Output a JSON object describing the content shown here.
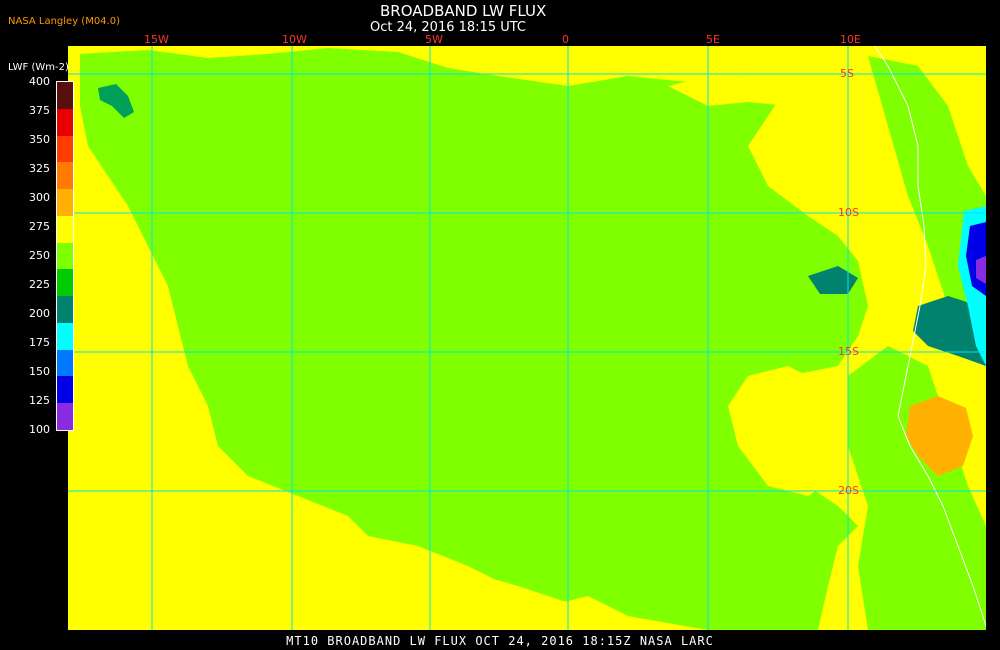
{
  "title": "BROADBAND LW FLUX",
  "subtitle": "Oct 24, 2016 18:15 UTC",
  "credit": "NASA Langley (M04.0)",
  "footer": "MT10  BROADBAND LW FLUX   OCT 24, 2016 18:15Z   NASA LARC",
  "legend": {
    "title": "LWF (Wm-2)",
    "ticks": [
      "400",
      "375",
      "350",
      "325",
      "300",
      "275",
      "250",
      "225",
      "200",
      "175",
      "150",
      "125",
      "100"
    ],
    "colors": [
      "#5a0f0f",
      "#e80000",
      "#ff3c00",
      "#ff7a00",
      "#ffb000",
      "#ffff00",
      "#7fff00",
      "#00cc00",
      "#00826e",
      "#00ffff",
      "#0078ff",
      "#0000e6",
      "#8a2be2"
    ]
  },
  "longitude_labels": [
    "15W",
    "10W",
    "5W",
    "0",
    "5E",
    "10E"
  ],
  "latitude_labels": [
    "5S",
    "10S",
    "15S",
    "20S"
  ],
  "map_colors": {
    "yellow": "#ffff00",
    "green": "#7fff00",
    "dark_green": "#00cc00",
    "teal": "#00826e",
    "orange": "#ffb000",
    "cyan": "#00ffff",
    "blue": "#0000e6",
    "purple": "#8a2be2",
    "grid": "#00e6e6",
    "coast": "#ffffff"
  }
}
